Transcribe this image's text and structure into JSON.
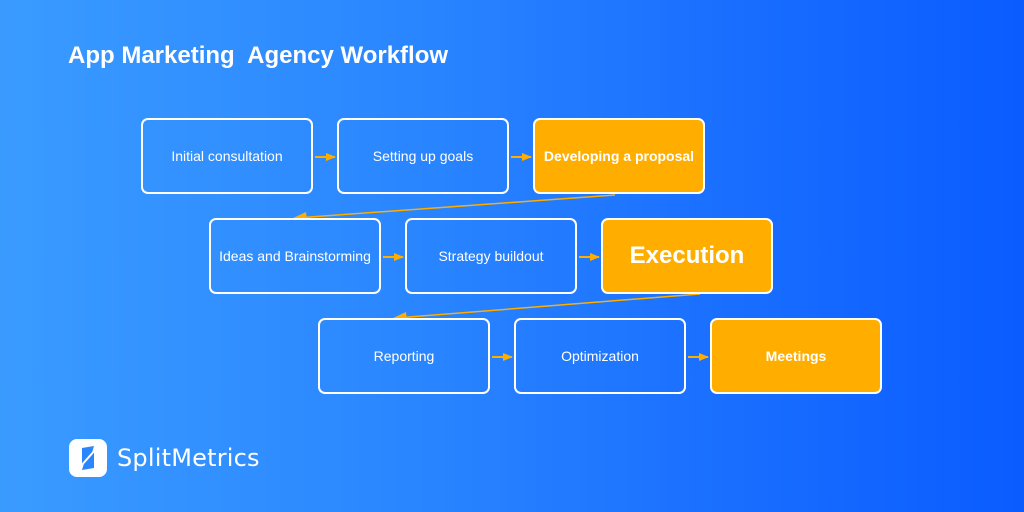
{
  "title": "App Marketing  Agency Workflow",
  "colors": {
    "background_left": "#3a9bff",
    "background_right": "#0a5cff",
    "highlight": "#ffae00",
    "connector": "#ffae00",
    "border": "#ffffff"
  },
  "rows": [
    {
      "steps": [
        {
          "label": "Initial consultation",
          "highlighted": false
        },
        {
          "label": "Setting up goals",
          "highlighted": false
        },
        {
          "label": "Developing a proposal",
          "highlighted": true
        }
      ]
    },
    {
      "steps": [
        {
          "label": "Ideas and Brainstorming",
          "highlighted": false
        },
        {
          "label": "Strategy buildout",
          "highlighted": false
        },
        {
          "label": "Execution",
          "highlighted": true
        }
      ]
    },
    {
      "steps": [
        {
          "label": "Reporting",
          "highlighted": false
        },
        {
          "label": "Optimization",
          "highlighted": false
        },
        {
          "label": "Meetings",
          "highlighted": true
        }
      ]
    }
  ],
  "flow": [
    [
      "Initial consultation",
      "Setting up goals"
    ],
    [
      "Setting up goals",
      "Developing a proposal"
    ],
    [
      "Developing a proposal",
      "Ideas and Brainstorming"
    ],
    [
      "Ideas and Brainstorming",
      "Strategy buildout"
    ],
    [
      "Strategy buildout",
      "Execution"
    ],
    [
      "Execution",
      "Reporting"
    ],
    [
      "Reporting",
      "Optimization"
    ],
    [
      "Optimization",
      "Meetings"
    ]
  ],
  "brand": {
    "name": "SplitMetrics",
    "icon": "splitmetrics-logo-icon"
  }
}
